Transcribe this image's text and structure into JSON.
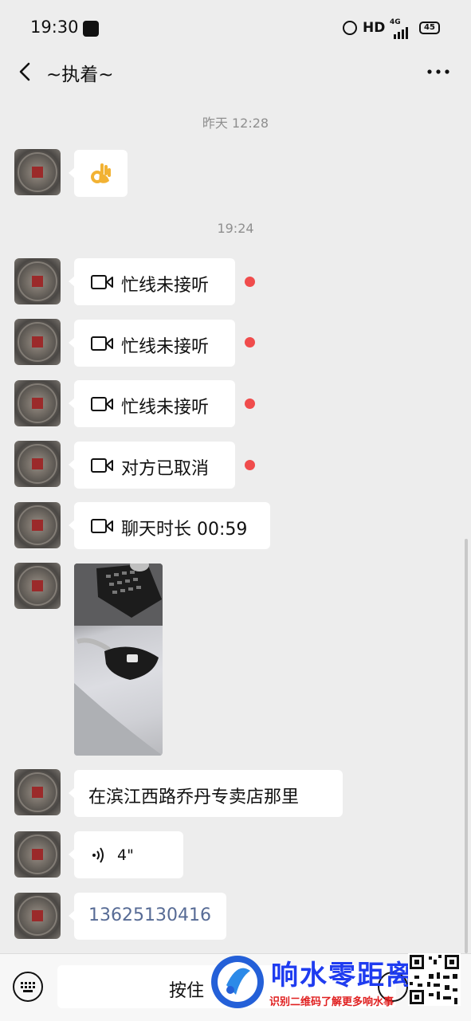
{
  "status_bar": {
    "time": "19:30",
    "hd": "HD",
    "network": "4G",
    "battery": "45"
  },
  "header": {
    "title": "~执着~"
  },
  "messages": {
    "t1": "昨天 12:28",
    "t2": "19:24",
    "call1": "忙线未接听",
    "call2": "忙线未接听",
    "call3": "忙线未接听",
    "call4": "对方已取消",
    "call5": "聊天时长 00:59",
    "location": "在滨江西路乔丹专卖店那里",
    "voice_duration": "4\"",
    "phone": "13625130416"
  },
  "input_bar": {
    "hold_to_talk": "按住"
  },
  "watermark": {
    "title": "响水零距离",
    "subtitle": "识别二维码了解更多响水事"
  },
  "colors": {
    "background": "#ededed",
    "bubble": "#ffffff",
    "missed_dot": "#f04c4c",
    "link": "#576b95",
    "watermark_blue": "#1f3cf0",
    "watermark_red": "#e02020"
  },
  "icons": {
    "back": "chevron-left-icon",
    "more": "more-dots-icon",
    "video_call": "video-camera-icon",
    "voice": "voice-wave-icon",
    "ok_hand": "ok-hand-emoji",
    "keyboard": "keyboard-icon"
  }
}
